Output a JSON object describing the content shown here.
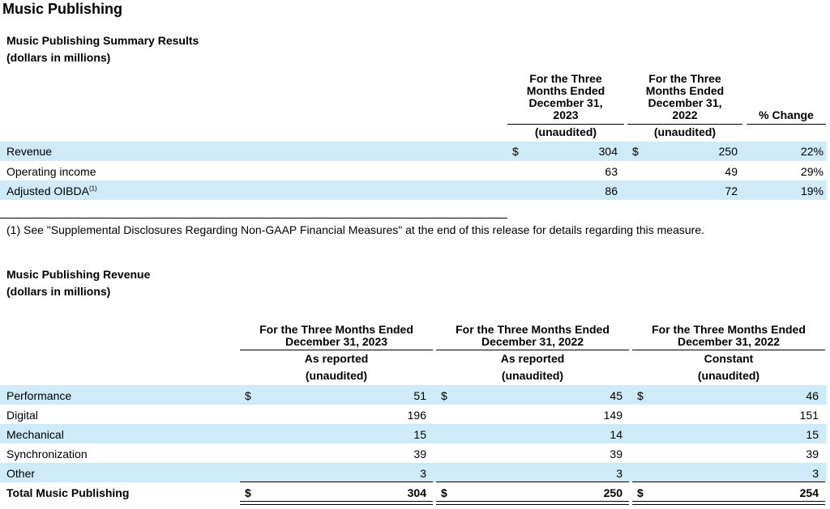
{
  "page_title": "Music Publishing",
  "summary": {
    "title": "Music Publishing Summary Results",
    "subtitle": "(dollars in millions)",
    "columns": [
      {
        "header": "For the Three Months Ended December 31, 2023",
        "h1": "For the Three",
        "h2": "Months Ended",
        "h3": "December 31,",
        "h4": "2023",
        "sub": "(unaudited)"
      },
      {
        "header": "For the Three Months Ended December 31, 2022",
        "h1": "For the Three",
        "h2": "Months Ended",
        "h3": "December 31,",
        "h4": "2022",
        "sub": "(unaudited)"
      },
      {
        "header": "% Change"
      }
    ],
    "currency": "$",
    "rows": [
      {
        "label": "Revenue",
        "v2023": "304",
        "v2022": "250",
        "change": "22%"
      },
      {
        "label": "Operating income",
        "v2023": "63",
        "v2022": "49",
        "change": "29%"
      },
      {
        "label": "Adjusted OIBDA",
        "sup": "(1)",
        "v2023": "86",
        "v2022": "72",
        "change": "19%"
      }
    ],
    "footnote": "(1) See \"Supplemental Disclosures Regarding Non-GAAP Financial Measures\" at the end of this release for details regarding this measure."
  },
  "revenue": {
    "title": "Music Publishing Revenue",
    "subtitle": "(dollars in millions)",
    "columns": [
      {
        "h1": "For the Three Months Ended",
        "h2": "December 31, 2023",
        "h3": "As reported",
        "sub": "(unaudited)"
      },
      {
        "h1": "For the Three Months Ended",
        "h2": "December 31, 2022",
        "h3": "As reported",
        "sub": "(unaudited)"
      },
      {
        "h1": "For the Three Months Ended",
        "h2": "December 31, 2022",
        "h3": "Constant",
        "sub": "(unaudited)"
      }
    ],
    "currency": "$",
    "rows": [
      {
        "label": "Performance",
        "a": "51",
        "b": "45",
        "c": "46"
      },
      {
        "label": "Digital",
        "a": "196",
        "b": "149",
        "c": "151"
      },
      {
        "label": "Mechanical",
        "a": "15",
        "b": "14",
        "c": "15"
      },
      {
        "label": "Synchronization",
        "a": "39",
        "b": "39",
        "c": "39"
      },
      {
        "label": "Other",
        "a": "3",
        "b": "3",
        "c": "3"
      }
    ],
    "total": {
      "label": "Total Music Publishing",
      "a": "304",
      "b": "250",
      "c": "254"
    }
  }
}
